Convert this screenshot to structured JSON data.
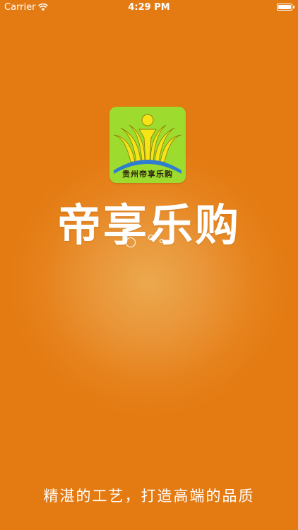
{
  "status_bar": {
    "carrier": "Carrier",
    "time": "4:29 PM",
    "icons": {
      "signal": "wifi-icon",
      "battery": "battery-icon"
    }
  },
  "logo": {
    "caption": "贵州帝享乐购",
    "icon": "figure-with-rays-logo",
    "colors": {
      "tile": "#9ddc2e",
      "rays": "#f7e417",
      "arc": "#2f7dcf"
    }
  },
  "brand": {
    "name": "帝享乐购"
  },
  "slogan": "精湛的工艺，打造高端的品质",
  "colors": {
    "background": "#e6821c",
    "text": "#ffffff"
  }
}
